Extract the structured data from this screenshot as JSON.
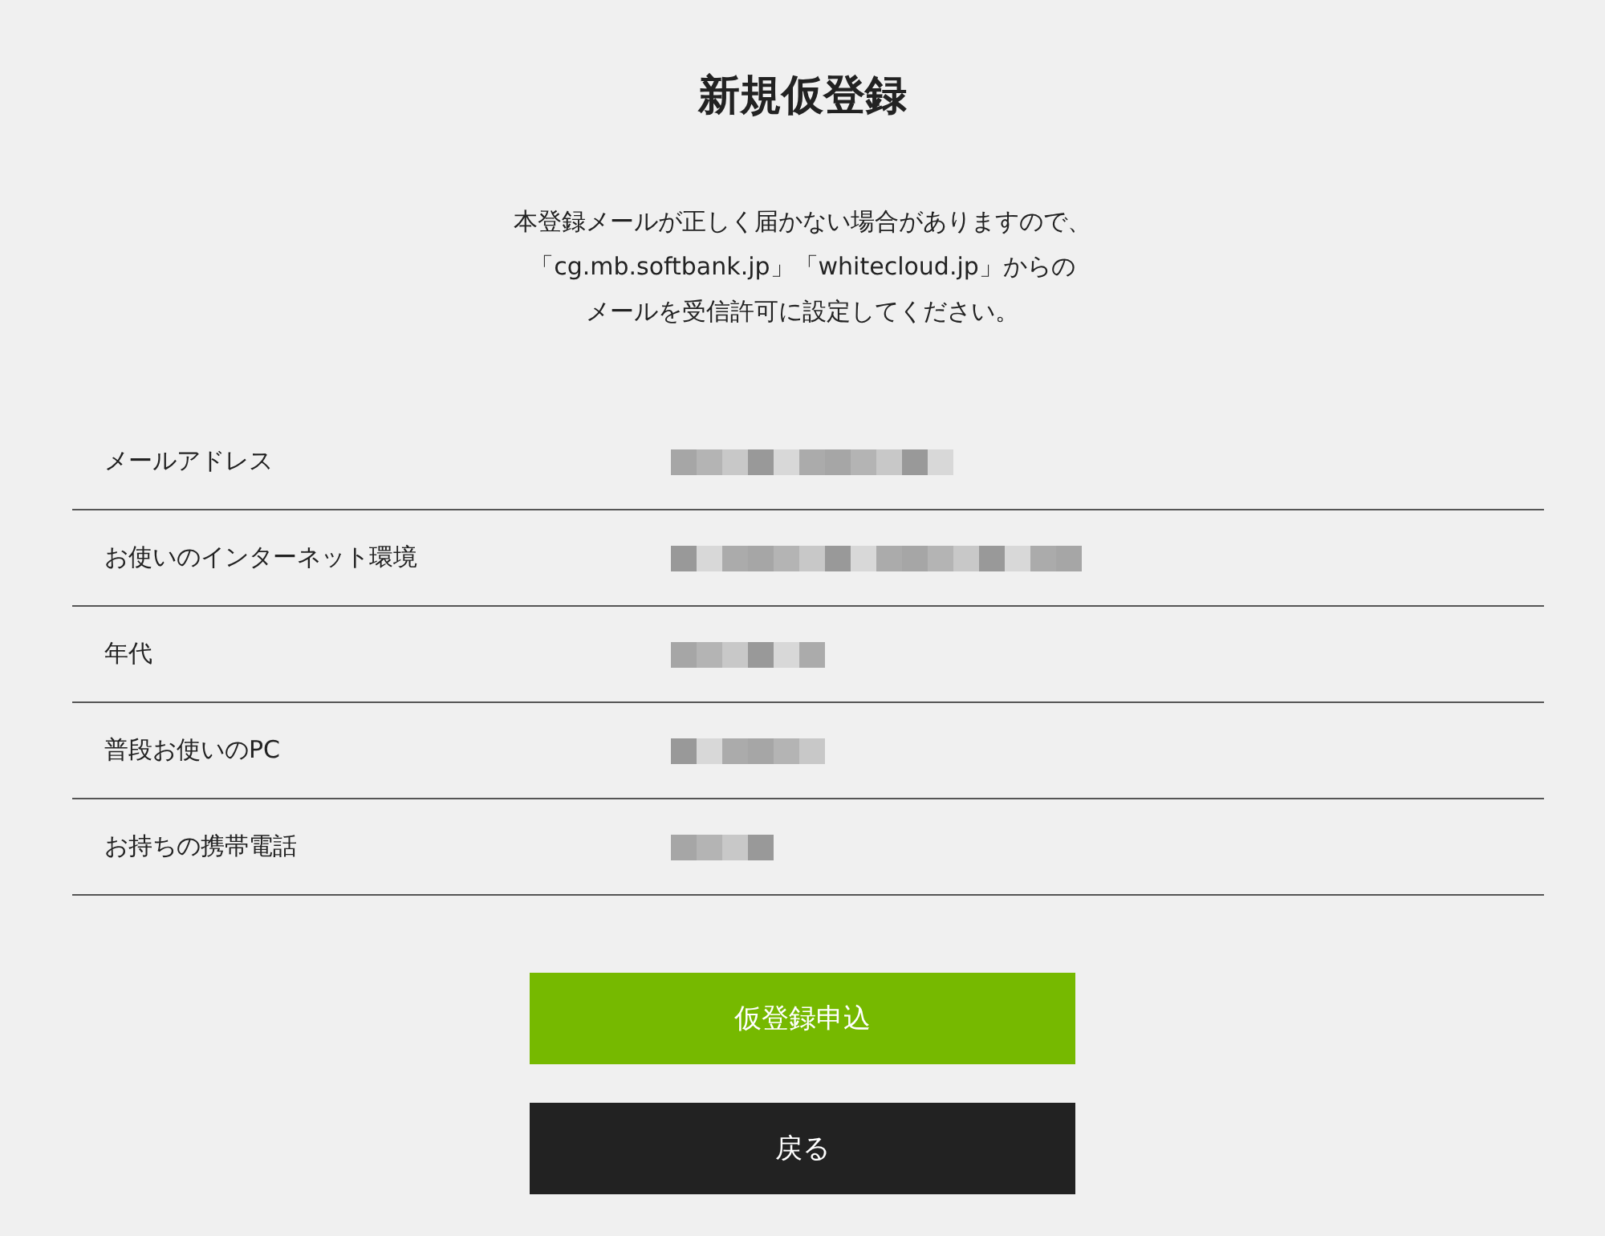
{
  "title": "新規仮登録",
  "notice": [
    "本登録メールが正しく届かない場合がありますので、",
    "「cg.mb.softbank.jp」「whitecloud.jp」からの",
    "メールを受信許可に設定してください。"
  ],
  "fields": [
    {
      "label": "メールアドレス"
    },
    {
      "label": "お使いのインターネット環境"
    },
    {
      "label": "年代"
    },
    {
      "label": "普段お使いのPC"
    },
    {
      "label": "お持ちの携帯電話"
    }
  ],
  "buttons": [
    {
      "label": "仮登録申込",
      "kind": "primary"
    },
    {
      "label": "戻る",
      "kind": "secondary"
    }
  ]
}
